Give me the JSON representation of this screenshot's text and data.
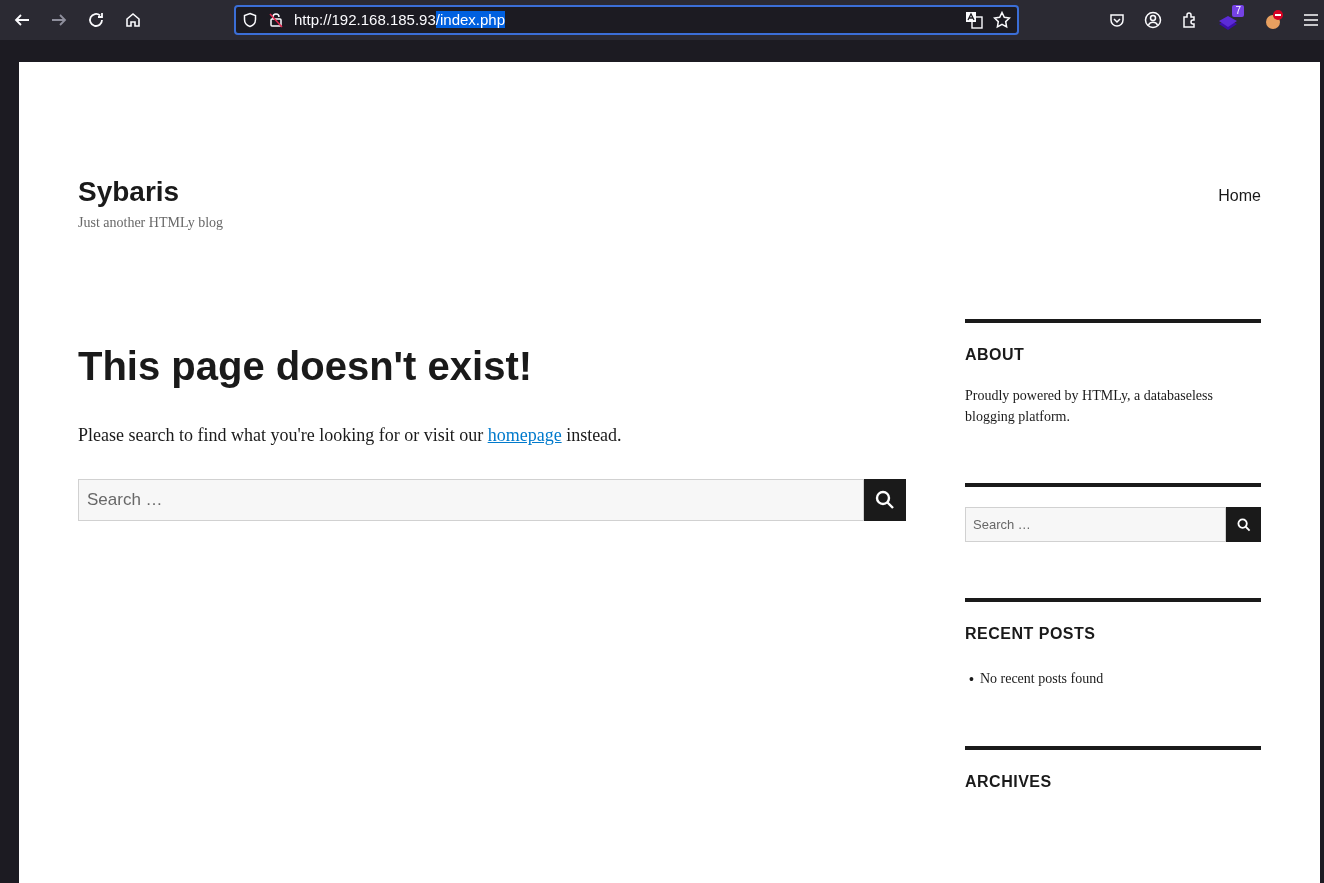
{
  "browser": {
    "url_host": "http://192.168.185.93",
    "url_selected": "/index.php",
    "extension_badge": "7"
  },
  "site": {
    "title": "Sybaris",
    "tagline": "Just another HTMLy blog",
    "nav": [
      {
        "label": "Home"
      }
    ]
  },
  "main": {
    "heading": "This page doesn't exist!",
    "message_before": "Please search to find what you're looking for or visit our ",
    "link": "homepage",
    "message_after": " instead.",
    "search_placeholder": "Search …"
  },
  "sidebar": [
    {
      "kind": "text",
      "title": "ABOUT",
      "text": "Proudly powered by HTMLy, a databaseless blogging platform."
    },
    {
      "kind": "search",
      "placeholder": "Search …"
    },
    {
      "kind": "list",
      "title": "RECENT POSTS",
      "items": [
        {
          "marker": "•",
          "text": "No recent posts found"
        }
      ]
    },
    {
      "kind": "list",
      "title": "ARCHIVES"
    }
  ]
}
